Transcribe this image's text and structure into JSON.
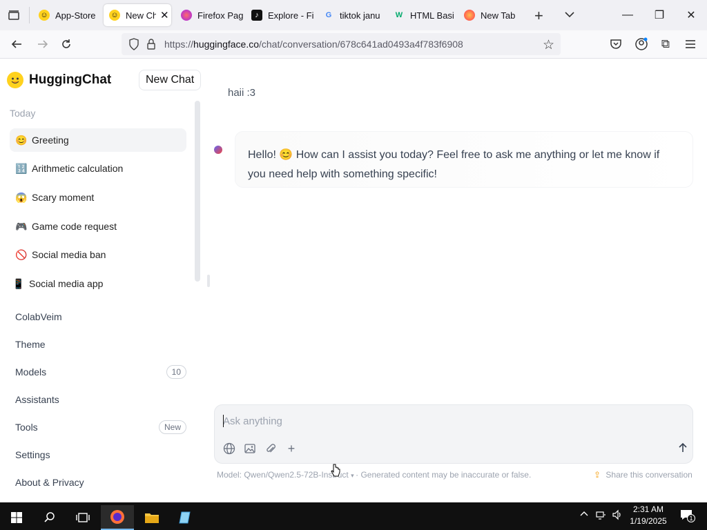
{
  "browser": {
    "tabs": [
      {
        "label": "App-Store",
        "favicon": "hugging-face-icon",
        "active": false
      },
      {
        "label": "New Cha",
        "favicon": "hugging-face-icon",
        "active": true
      },
      {
        "label": "Firefox Pag",
        "favicon": "firefox-icon",
        "active": false
      },
      {
        "label": "Explore - Fi",
        "favicon": "tiktok-icon",
        "active": false
      },
      {
        "label": "tiktok janu",
        "favicon": "google-icon",
        "active": false
      },
      {
        "label": "HTML Basi",
        "favicon": "w3schools-icon",
        "active": false
      },
      {
        "label": "New Tab",
        "favicon": "firefox-icon",
        "active": false
      }
    ],
    "url_prefix": "https://",
    "url_host": "huggingface.co",
    "url_path": "/chat/conversation/678c641ad0493a4f783f6908"
  },
  "sidebar": {
    "brand": "HuggingChat",
    "new_chat": "New Chat",
    "section_today": "Today",
    "conversations": [
      {
        "label": "Greeting",
        "emoji": "😊"
      },
      {
        "label": "Arithmetic calculation",
        "emoji": "🔢"
      },
      {
        "label": "Scary moment",
        "emoji": "😱"
      },
      {
        "label": "Game code request",
        "emoji": "🎮"
      },
      {
        "label": "Social media ban",
        "emoji": "🚫"
      },
      {
        "label": "Social media app",
        "emoji": "📱"
      }
    ],
    "menu": {
      "user": "ColabVeim",
      "theme": "Theme",
      "models": "Models",
      "models_count": "10",
      "assistants": "Assistants",
      "tools": "Tools",
      "tools_badge": "New",
      "settings": "Settings",
      "about": "About & Privacy"
    }
  },
  "chat": {
    "user_message": "haii :3",
    "assistant_line1": "Hello! 😊 How can I assist you today? Feel free to ask me anything or let me know if",
    "assistant_line2": "you need help with something specific!",
    "input_placeholder": "Ask anything",
    "model_label": "Model: Qwen/Qwen2.5-72B-Instruct",
    "disclaimer": "· Generated content may be inaccurate or false.",
    "share": "Share this conversation"
  },
  "taskbar": {
    "time": "2:31 AM",
    "date": "1/19/2025",
    "notification_count": "1"
  },
  "colors": {
    "accent": "#ffd21e",
    "tab_strip": "#f0f0f4",
    "taskbar": "#101010"
  }
}
